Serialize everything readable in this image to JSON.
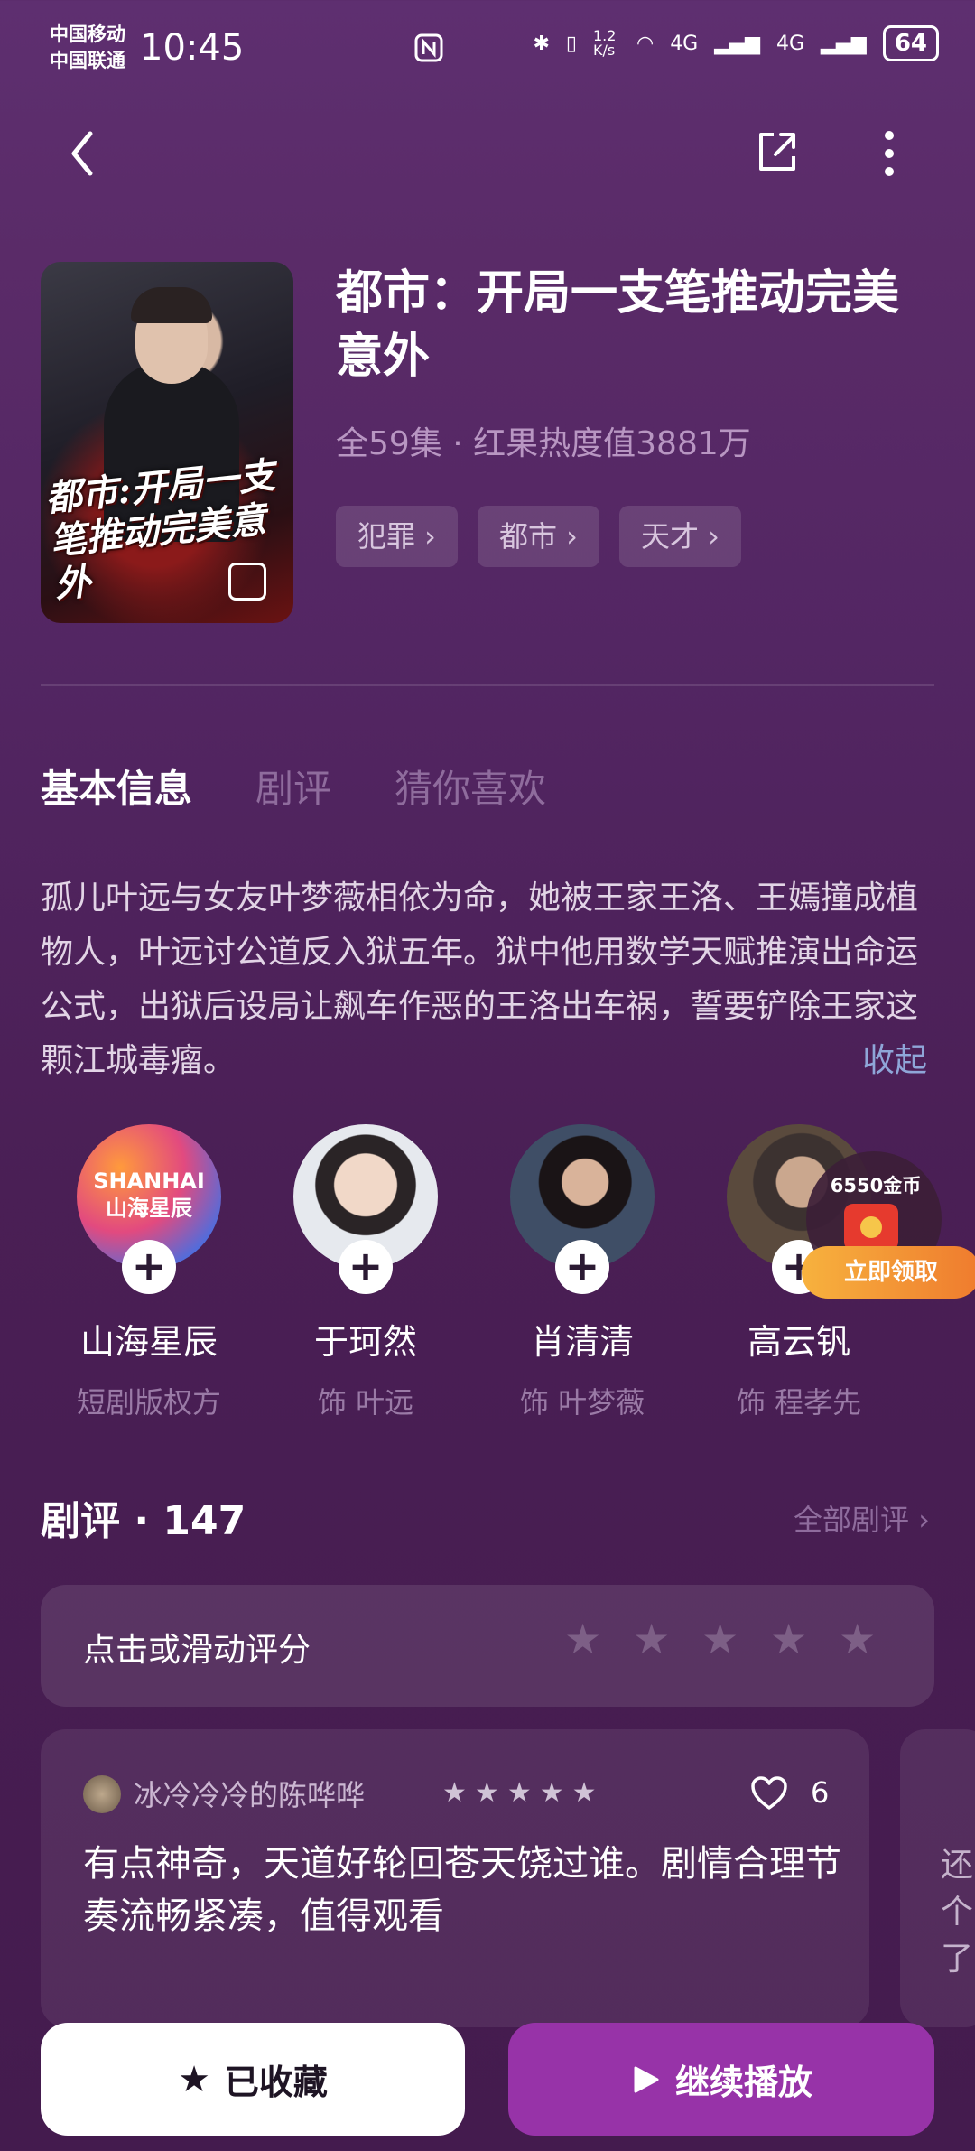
{
  "status_bar": {
    "carrier1": "中国移动",
    "carrier2": "中国联通",
    "time": "10:45",
    "speed": "1.2 K/s",
    "net1": "4G",
    "net2": "4G",
    "battery": "64"
  },
  "drama": {
    "title": "都市：开局一支笔推动完美意外",
    "poster_title": "都市:开局一支笔推动完美意外",
    "meta": "全59集 · 红果热度值3881万",
    "tags": [
      "犯罪 ›",
      "都市 ›",
      "天才 ›"
    ]
  },
  "tabs": [
    "基本信息",
    "剧评",
    "猜你喜欢"
  ],
  "synopsis": "孤儿叶远与女友叶梦薇相依为命，她被王家王洛、王嫣撞成植物人，叶远讨公道反入狱五年。狱中他用数学天赋推演出命运公式，出狱后设局让飙车作恶的王洛出车祸，誓要铲除王家这颗江城毒瘤。",
  "collapse_label": "收起",
  "cast": [
    {
      "name": "山海星辰",
      "role": "短剧版权方",
      "avatar_text": "SHANHAI\n山海星辰"
    },
    {
      "name": "于珂然",
      "role": "饰 叶远"
    },
    {
      "name": "肖清清",
      "role": "饰 叶梦薇"
    },
    {
      "name": "高云钒",
      "role": "饰 程孝先"
    }
  ],
  "promo": {
    "coins": "6550金币",
    "button": "立即领取"
  },
  "reviews": {
    "title": "剧评 · 147",
    "all_label": "全部剧评 ›",
    "rate_prompt": "点击或滑动评分",
    "items": [
      {
        "user": "冰冷冷冷的陈哗哗",
        "likes": "6",
        "text": "有点神奇，天道好轮回苍天饶过谁。剧情合理节奏流畅紧凑，值得观看"
      }
    ],
    "next_preview": "还个了"
  },
  "actions": {
    "favorite": "已收藏",
    "play": "继续播放"
  },
  "colors": {
    "accent": "#9733a8",
    "background": "#532663",
    "promo": "#ef7b2e"
  }
}
